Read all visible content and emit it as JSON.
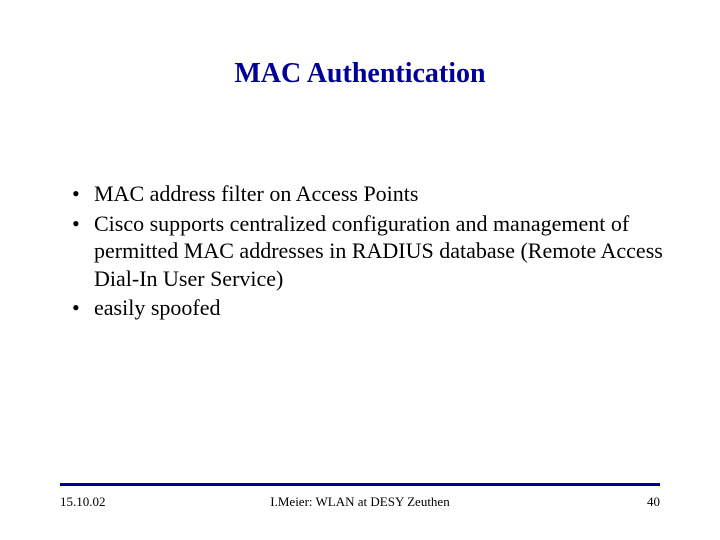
{
  "title": "MAC Authentication",
  "bullets": [
    "MAC address filter on Access Points",
    "Cisco supports centralized configuration and management of permitted MAC addresses in RADIUS database (Remote Access Dial-In User Service)",
    "easily spoofed"
  ],
  "footer": {
    "date": "15.10.02",
    "center": "I.Meier: WLAN at DESY Zeuthen",
    "page": "40"
  },
  "colors": {
    "title": "#000099",
    "rule": "#000099"
  }
}
